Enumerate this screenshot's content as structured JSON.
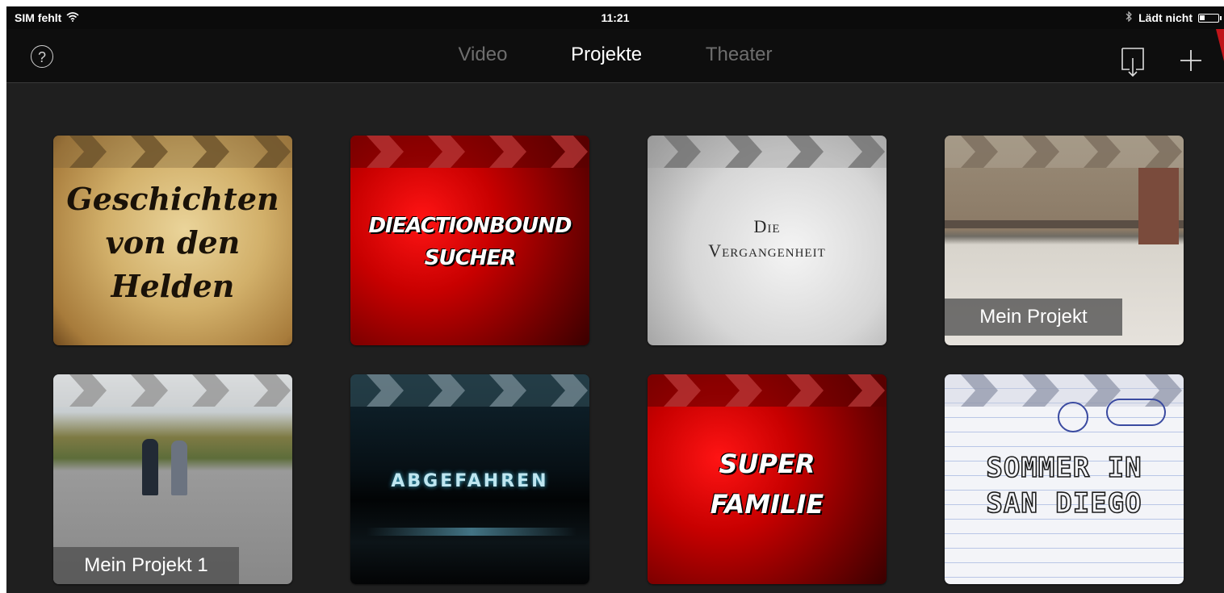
{
  "statusbar": {
    "carrier": "SIM fehlt",
    "time": "11:21",
    "battery_text": "Lädt nicht",
    "wifi_icon": "wifi-icon",
    "bluetooth_icon": "bluetooth-icon"
  },
  "navbar": {
    "help_label": "?",
    "tabs": [
      {
        "label": "Video"
      },
      {
        "label": "Projekte"
      },
      {
        "label": "Theater"
      }
    ],
    "active_tab": "Projekte"
  },
  "projects": [
    {
      "title_line1": "Geschichten",
      "title_line2": "von den",
      "title_line3": "Helden"
    },
    {
      "title_line1": "DieActionbound",
      "title_line2": "Sucher"
    },
    {
      "title_line1": "Die",
      "title_line2": "Vergangenheit"
    },
    {
      "label": "Mein Projekt"
    },
    {
      "label": "Mein Projekt 1"
    },
    {
      "title_line1": "Abgefahren"
    },
    {
      "title_line1": "Super",
      "title_line2": "Familie"
    },
    {
      "title_line1": "Sommer in",
      "title_line2": "San Diego"
    }
  ],
  "colors": {
    "background": "#1f1f1f",
    "navbar": "#0e0e0e",
    "active_tab": "#ffffff",
    "inactive_tab": "#6e6e6e",
    "accent_arrow": "#c0151a"
  }
}
